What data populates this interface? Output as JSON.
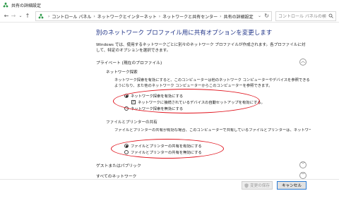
{
  "window": {
    "title": "共有の詳細設定"
  },
  "address_bar": {
    "breadcrumbs": [
      "コントロール パネル",
      "ネットワークとインターネット",
      "ネットワークと共有センター",
      "共有の詳細設定"
    ],
    "separator": "›",
    "search_placeholder": "コントロール パネルの検索"
  },
  "main": {
    "title": "別のネットワーク プロファイル用に共有オプションを変更します",
    "description": "Windows では、使用するネットワークごとに別々のネットワーク プロファイルが作成されます。各プロファイルに対して、特定のオプションを選択できます。",
    "profiles": [
      {
        "label": "プライベート (現在のプロファイル)",
        "expanded": true,
        "sections": [
          {
            "heading": "ネットワーク探索",
            "text": "ネットワーク探索を有効にすると、このコンピューターは他のネットワーク コンピューターやデバイスを参照できるようになり、また他のネットワーク コンピューターからこのコンピューターを参照できます。",
            "options": {
              "on": "ネットワーク探索を有効にする",
              "auto_setup": "ネットワークに接続されているデバイスの自動セットアップを有効にする。",
              "off": "ネットワーク探索を無効にする"
            },
            "selected": "on",
            "auto_setup_checked": true
          },
          {
            "heading": "ファイルとプリンターの共有",
            "text": "ファイルとプリンターの共有が有効な場合、このコンピューターで共有しているファイルとプリンターは、ネットワーク上のユーザーからアクセス可能になります。",
            "options": {
              "on": "ファイルとプリンターの共有を有効にする",
              "off": "ファイルとプリンターの共有を無効にする"
            },
            "selected": "on"
          }
        ]
      },
      {
        "label": "ゲストまたはパブリック",
        "expanded": false
      },
      {
        "label": "すべてのネットワーク",
        "expanded": false
      }
    ]
  },
  "footer": {
    "save_label": "変更の保存",
    "cancel_label": "キャンセル"
  },
  "icons": {
    "up_chevron": "︿",
    "down_chevron": "﹀",
    "check": "✓",
    "back": "←",
    "forward": "→",
    "up": "↑",
    "dropdown": "⌄",
    "refresh": "↻"
  },
  "colors": {
    "title_blue": "#1e3287",
    "highlight_red": "#e0101a",
    "network_green": "#2e9a4a"
  }
}
